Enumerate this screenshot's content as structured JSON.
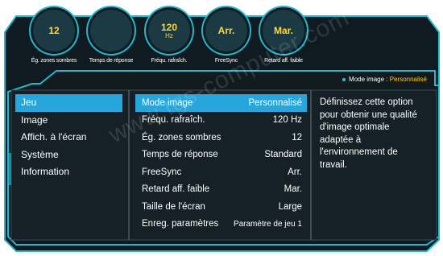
{
  "dials": [
    {
      "value": "12",
      "unit": "",
      "label": "Ég. zones sombres"
    },
    {
      "value": "",
      "unit": "",
      "label": "Temps de réponse"
    },
    {
      "value": "120",
      "unit": "Hz",
      "label": "Fréqu. rafraîch."
    },
    {
      "value": "Arr.",
      "unit": "",
      "label": "FreeSync"
    },
    {
      "value": "Mar.",
      "unit": "",
      "label": "Retard aff. faible"
    }
  ],
  "response_gauge_level": 0.62,
  "mode_indicator": {
    "label": "Mode image :",
    "value": "Personnalisé"
  },
  "left_menu": [
    "Jeu",
    "Image",
    "Affich. à l'écran",
    "Système",
    "Information"
  ],
  "settings": [
    {
      "name": "Mode image",
      "value": "Personnalisé"
    },
    {
      "name": "Fréqu. rafraîch.",
      "value": "120 Hz"
    },
    {
      "name": "Ég. zones sombres",
      "value": "12"
    },
    {
      "name": "Temps de réponse",
      "value": "Standard"
    },
    {
      "name": "FreeSync",
      "value": "Arr."
    },
    {
      "name": "Retard aff. faible",
      "value": "Mar."
    },
    {
      "name": "Taille de l'écran",
      "value": "Large"
    },
    {
      "name": "Enreg. paramètres",
      "value": "Paramètre de jeu 1"
    }
  ],
  "description": "Définissez cette option pour obtenir une qualité d'image optimale adaptée à l'environnement de travail.",
  "watermark": "www.tgs-computer.com",
  "colors": {
    "accent": "#22b8cf",
    "highlight": "#26a6dc",
    "value_yellow": "#ffd83a",
    "panel_bg": "#0f1b20"
  }
}
